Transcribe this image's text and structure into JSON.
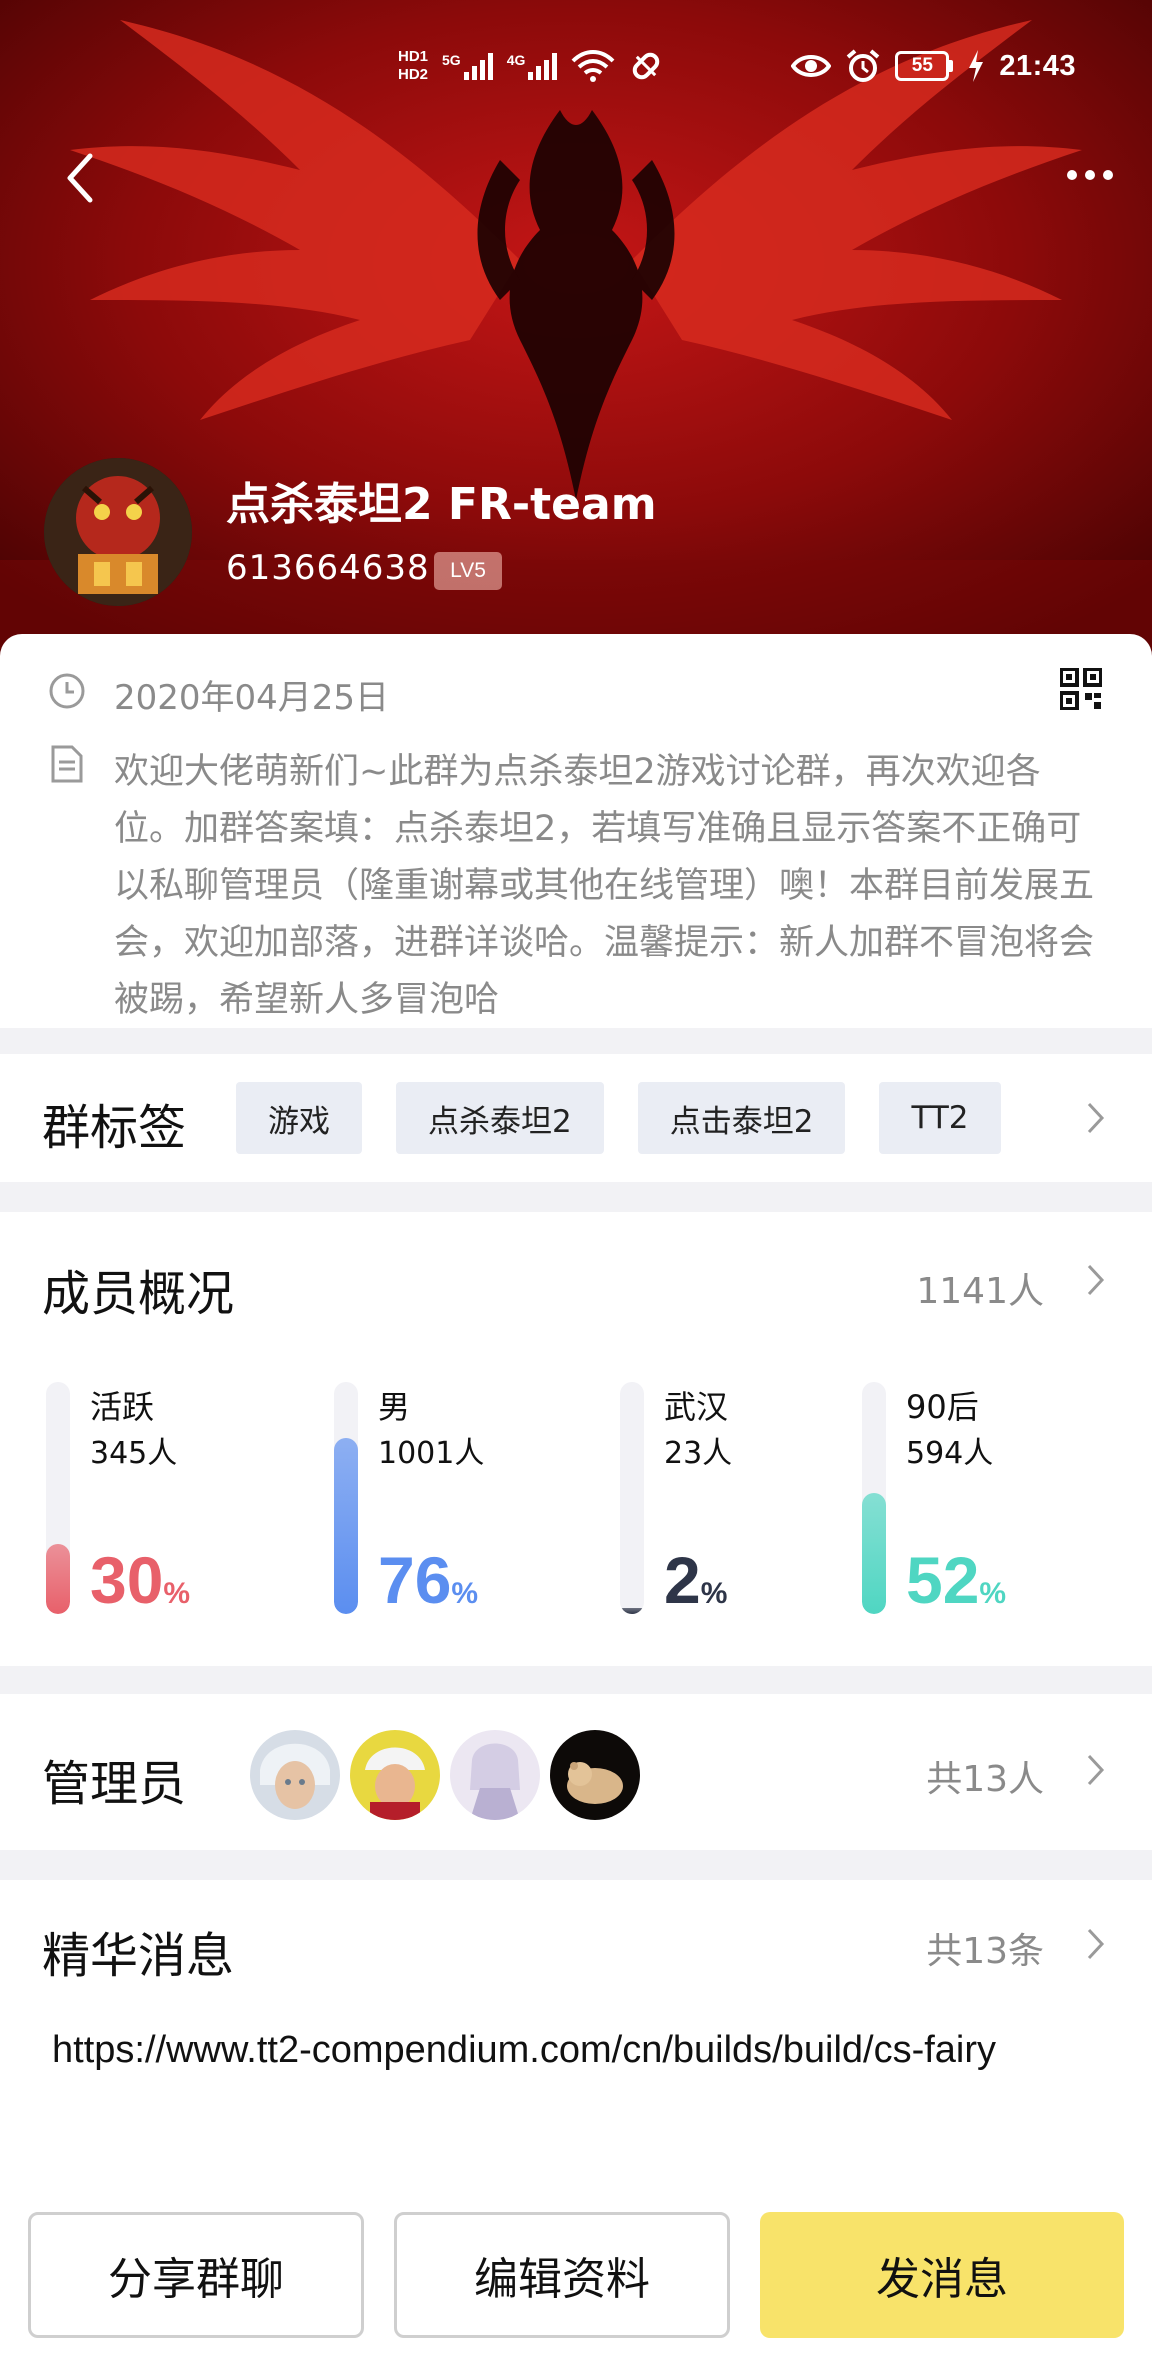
{
  "status_bar": {
    "hd1": "HD1",
    "hd2": "HD2",
    "sig1_label": "5G",
    "sig2_label": "4G",
    "wifi_label": "6",
    "battery": "55",
    "time": "21:43"
  },
  "group": {
    "name": "点杀泰坦2 FR-team",
    "id": "613664638",
    "level": "LV5"
  },
  "info": {
    "date": "2020年04月25日",
    "description": "欢迎大佬萌新们~此群为点杀泰坦2游戏讨论群，再次欢迎各位。加群答案填：点杀泰坦2，若填写准确且显示答案不正确可以私聊管理员（隆重谢幕或其他在线管理）噢！本群目前发展五会，欢迎加部落，进群详谈哈。温馨提示：新人加群不冒泡将会被踢，希望新人多冒泡哈"
  },
  "tags_section": {
    "title": "群标签",
    "tags": [
      "游戏",
      "点杀泰坦2",
      "点击泰坦2",
      "TT2"
    ]
  },
  "members_section": {
    "title": "成员概况",
    "count": "1141人",
    "stats": [
      {
        "label": "活跃",
        "count": "345人",
        "percent": "30",
        "unit": "%",
        "value": 0.3,
        "color": "#e8606a"
      },
      {
        "label": "男",
        "count": "1001人",
        "percent": "76",
        "unit": "%",
        "value": 0.76,
        "color": "#5b8ef0"
      },
      {
        "label": "武汉",
        "count": "23人",
        "percent": "2",
        "unit": "%",
        "value": 0.02,
        "color": "#2e3548"
      },
      {
        "label": "90后",
        "count": "594人",
        "percent": "52",
        "unit": "%",
        "value": 0.52,
        "color": "#4fd6c2"
      }
    ]
  },
  "admins_section": {
    "title": "管理员",
    "count": "共13人"
  },
  "featured_section": {
    "title": "精华消息",
    "count": "共13条",
    "link": "https://www.tt2-compendium.com/cn/builds/build/cs-fairy"
  },
  "actions": {
    "share": "分享群聊",
    "edit": "编辑资料",
    "send": "发消息"
  },
  "colors": {
    "accent_yellow": "#f8e36a",
    "header_red": "#6a0505"
  }
}
